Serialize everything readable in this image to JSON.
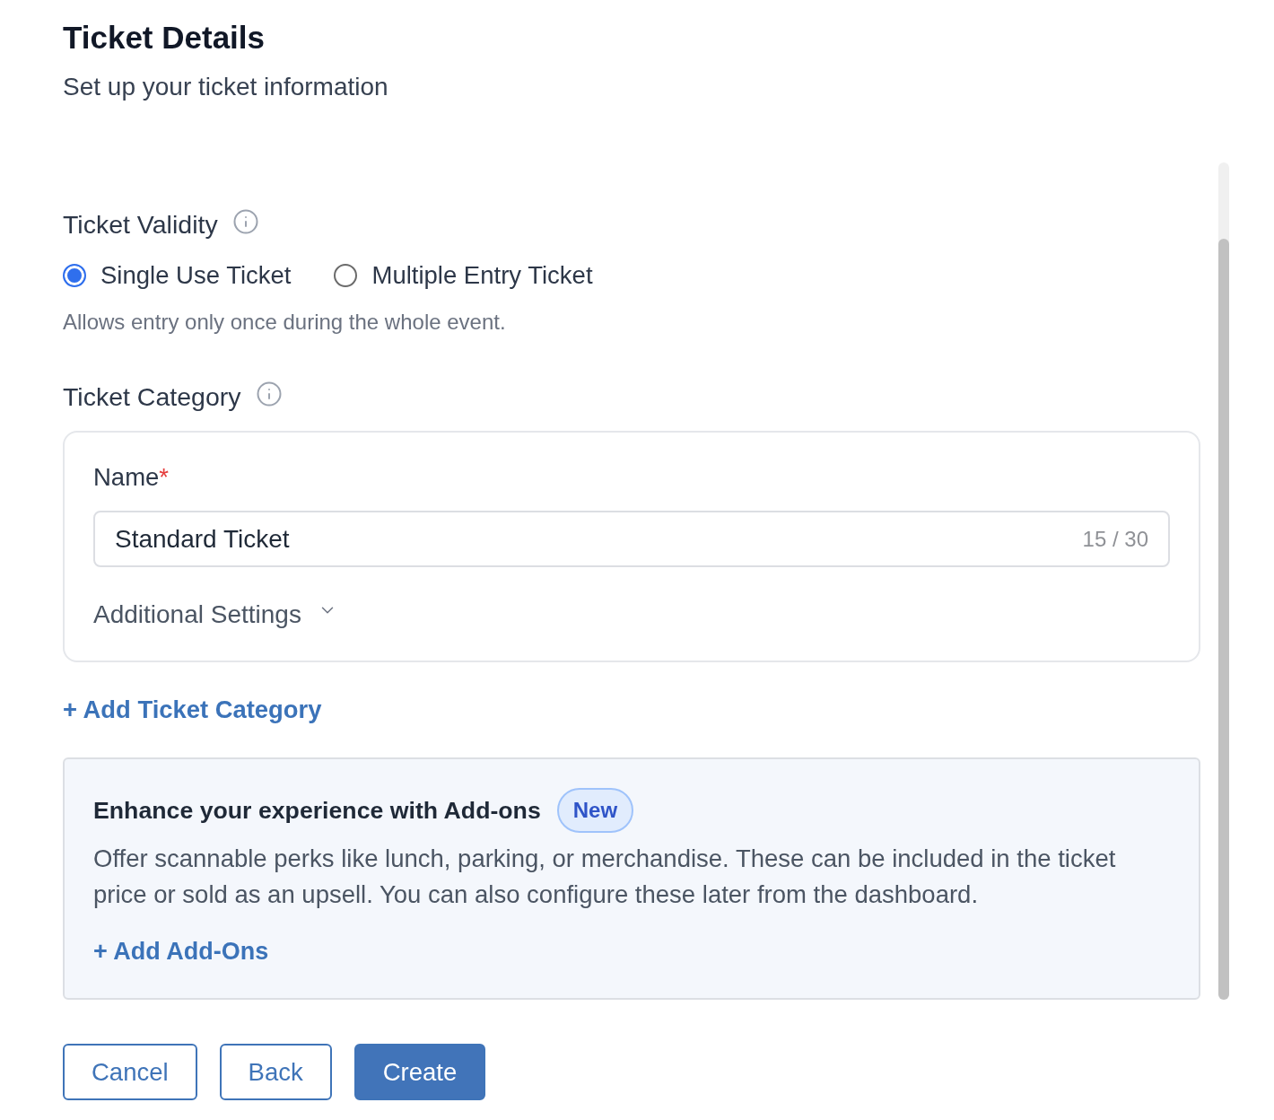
{
  "header": {
    "title": "Ticket Details",
    "subtitle": "Set up your ticket information"
  },
  "validity": {
    "label": "Ticket Validity",
    "options": [
      {
        "label": "Single Use Ticket",
        "selected": true
      },
      {
        "label": "Multiple Entry Ticket",
        "selected": false
      }
    ],
    "help": "Allows entry only once during the whole event."
  },
  "category": {
    "label": "Ticket Category",
    "name_field": {
      "label": "Name",
      "required_mark": "*",
      "value": "Standard Ticket",
      "counter": "15 / 30"
    },
    "additional_settings": {
      "label": "Additional Settings",
      "expanded": false
    },
    "add_link": "+ Add Ticket Category"
  },
  "addons": {
    "title": "Enhance your experience with Add-ons",
    "badge": "New",
    "description": "Offer scannable perks like lunch, parking, or merchandise. These can be included in the ticket price or sold as an upsell. You can also configure these later from the dashboard.",
    "add_link": "+ Add Add-Ons"
  },
  "buttons": [
    {
      "label": "Cancel",
      "kind": "outline"
    },
    {
      "label": "Back",
      "kind": "outline"
    },
    {
      "label": "Create",
      "kind": "primary"
    }
  ]
}
